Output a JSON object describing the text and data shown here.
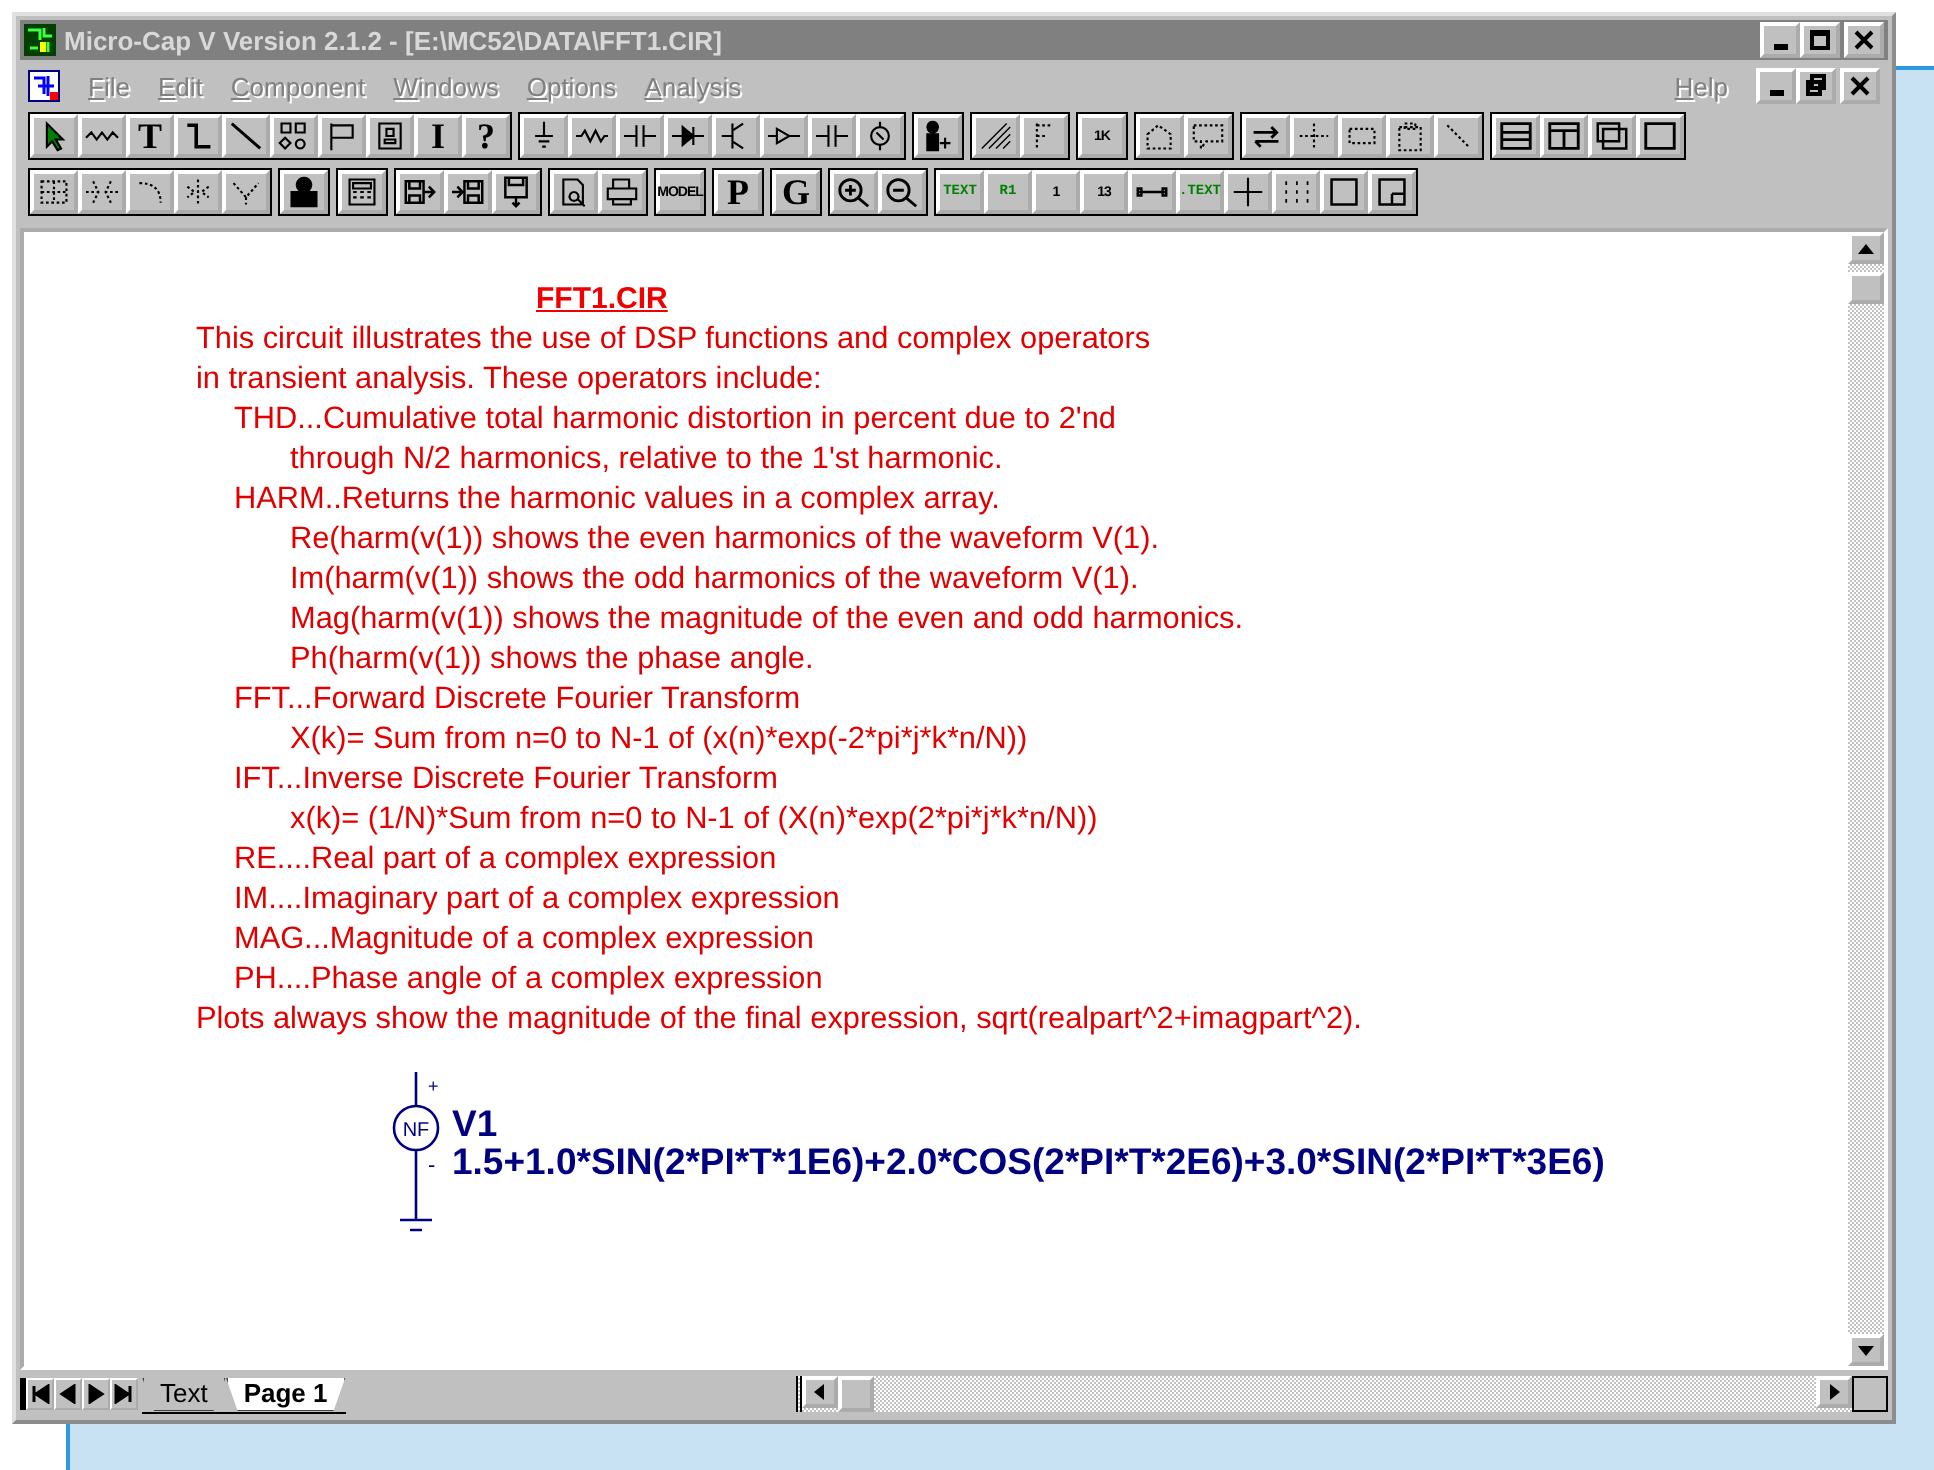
{
  "window": {
    "title": "Micro-Cap V Version 2.1.2 - [E:\\MC52\\DATA\\FFT1.CIR]"
  },
  "menu": {
    "items": [
      {
        "label": "File",
        "disabled": true
      },
      {
        "label": "Edit",
        "disabled": true
      },
      {
        "label": "Component",
        "disabled": true
      },
      {
        "label": "Windows",
        "disabled": true
      },
      {
        "label": "Options",
        "disabled": true
      },
      {
        "label": "Analysis",
        "disabled": true
      }
    ],
    "help": {
      "label": "Help",
      "disabled": true
    }
  },
  "toolbars": [
    [
      [
        {
          "kind": "arrow"
        },
        {
          "kind": "zigzag"
        },
        {
          "kind": "label",
          "label": "T"
        },
        {
          "kind": "step"
        },
        {
          "kind": "diagonal"
        },
        {
          "kind": "shapes"
        },
        {
          "kind": "flag"
        },
        {
          "kind": "portrait"
        },
        {
          "kind": "label",
          "label": "I"
        },
        {
          "kind": "label",
          "label": "?"
        }
      ],
      [
        {
          "kind": "ground"
        },
        {
          "kind": "resistor"
        },
        {
          "kind": "capacitor"
        },
        {
          "kind": "diode"
        },
        {
          "kind": "transistor"
        },
        {
          "kind": "buffer"
        },
        {
          "kind": "capacitor"
        },
        {
          "kind": "source"
        }
      ],
      [
        {
          "kind": "person-plus"
        }
      ],
      [
        {
          "kind": "hatch"
        },
        {
          "kind": "dotted-f"
        }
      ],
      [
        {
          "kind": "small-label",
          "label": "1K"
        }
      ],
      [
        {
          "kind": "dotted-tag"
        },
        {
          "kind": "dotted-box"
        }
      ],
      [
        {
          "kind": "loop-arrows"
        },
        {
          "kind": "dotted-cross"
        },
        {
          "kind": "dotted-rect"
        },
        {
          "kind": "dotted-clip"
        },
        {
          "kind": "dotted-diag"
        }
      ],
      [
        {
          "kind": "split-h"
        },
        {
          "kind": "split-v"
        },
        {
          "kind": "cascade"
        },
        {
          "kind": "blank"
        }
      ]
    ],
    [
      [
        {
          "kind": "dotted-grid"
        },
        {
          "kind": "dotted-arrows"
        },
        {
          "kind": "dotted-rotate"
        },
        {
          "kind": "dotted-flip"
        },
        {
          "kind": "dotted-mirror"
        }
      ],
      [
        {
          "kind": "person"
        }
      ],
      [
        {
          "kind": "calculator"
        }
      ],
      [
        {
          "kind": "save-right"
        },
        {
          "kind": "right-save"
        },
        {
          "kind": "save-down"
        }
      ],
      [
        {
          "kind": "preview"
        },
        {
          "kind": "printer"
        }
      ],
      [
        {
          "kind": "small-label",
          "label": "MODEL"
        }
      ],
      [
        {
          "kind": "label",
          "label": "P"
        }
      ],
      [
        {
          "kind": "label",
          "label": "G"
        }
      ],
      [
        {
          "kind": "zoom-in"
        },
        {
          "kind": "zoom-out"
        }
      ],
      [
        {
          "kind": "green-label",
          "label": "TEXT"
        },
        {
          "kind": "green-label",
          "label": "R1"
        },
        {
          "kind": "small-label",
          "label": "1"
        },
        {
          "kind": "small-label",
          "label": "13"
        },
        {
          "kind": "line-dots"
        },
        {
          "kind": "green-label",
          "label": ".TEXT"
        },
        {
          "kind": "cross"
        },
        {
          "kind": "dots"
        },
        {
          "kind": "square"
        },
        {
          "kind": "square-small"
        }
      ]
    ]
  ],
  "document": {
    "title": "FFT1.CIR",
    "lines": [
      {
        "text": "This circuit illustrates the use of DSP functions and complex operators"
      },
      {
        "text": "in transient analysis. These operators include:",
        "children": [
          {
            "text": "THD...Cumulative total harmonic distortion in percent due to 2'nd",
            "children": [
              {
                "text": "through N/2 harmonics, relative to the 1'st harmonic."
              }
            ]
          },
          {
            "text": "HARM..Returns the harmonic values in a complex array.",
            "children": [
              {
                "text": "Re(harm(v(1)) shows the even harmonics of the waveform V(1)."
              },
              {
                "text": "Im(harm(v(1)) shows the odd harmonics of the waveform V(1)."
              },
              {
                "text": "Mag(harm(v(1)) shows the magnitude of the even and odd harmonics."
              },
              {
                "text": "Ph(harm(v(1)) shows the phase angle."
              }
            ]
          },
          {
            "text": "FFT...Forward Discrete Fourier Transform",
            "children": [
              {
                "text": "X(k)= Sum from n=0 to N-1 of (x(n)*exp(-2*pi*j*k*n/N))"
              }
            ]
          },
          {
            "text": "IFT...Inverse Discrete Fourier Transform",
            "children": [
              {
                "text": "x(k)= (1/N)*Sum from n=0 to N-1 of (X(n)*exp(2*pi*j*k*n/N))"
              }
            ]
          },
          {
            "text": "RE....Real part of a complex expression"
          },
          {
            "text": "IM....Imaginary part of a complex expression"
          },
          {
            "text": "MAG...Magnitude of a complex expression"
          },
          {
            "text": "PH....Phase angle of a complex expression"
          }
        ]
      },
      {
        "text": "Plots always show the magnitude of the final expression, sqrt(realpart^2+imagpart^2)."
      }
    ],
    "component": {
      "symbol": "NF",
      "plus": "+",
      "minus": "-",
      "name": "V1",
      "value": "1.5+1.0*SIN(2*PI*T*1E6)+2.0*COS(2*PI*T*2E6)+3.0*SIN(2*PI*T*3E6)"
    }
  },
  "page_tabs": [
    {
      "label": "Text",
      "selected": false
    },
    {
      "label": "Page 1",
      "selected": true
    }
  ]
}
